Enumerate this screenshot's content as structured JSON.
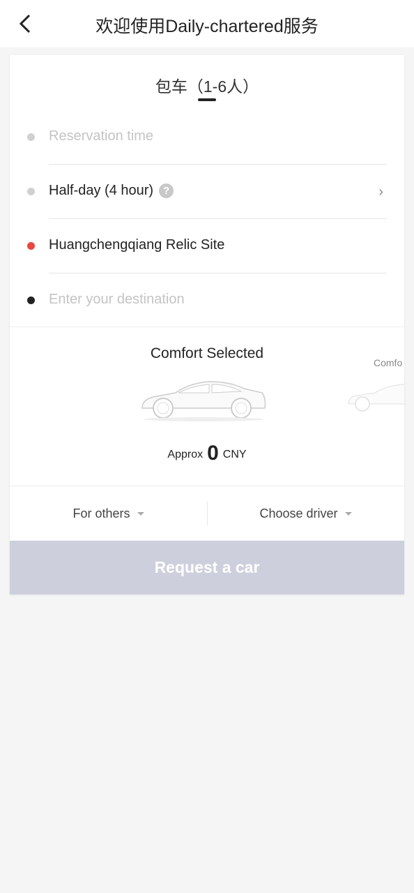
{
  "header": {
    "title": "欢迎使用Daily-chartered服务",
    "back_icon": "chevron-left-icon"
  },
  "tab": {
    "label": "包车（1-6人）"
  },
  "form": {
    "reservation_placeholder": "Reservation time",
    "duration": "Half-day (4 hour)",
    "pickup": "Huangchengqiang Relic Site",
    "destination_placeholder": "Enter your destination",
    "colors": {
      "pickup_dot": "#e8473e",
      "destination_dot": "#222222",
      "inactive_dot": "#d0d0d0"
    }
  },
  "cars": {
    "selected": "Comfort Selected",
    "next": "Comfo",
    "approx": "Approx",
    "price": "0",
    "currency": "CNY"
  },
  "options": {
    "for_others": "For others",
    "choose_driver": "Choose driver"
  },
  "request_button": "Request a car",
  "colors": {
    "request_button_bg": "#cdd0dc"
  }
}
